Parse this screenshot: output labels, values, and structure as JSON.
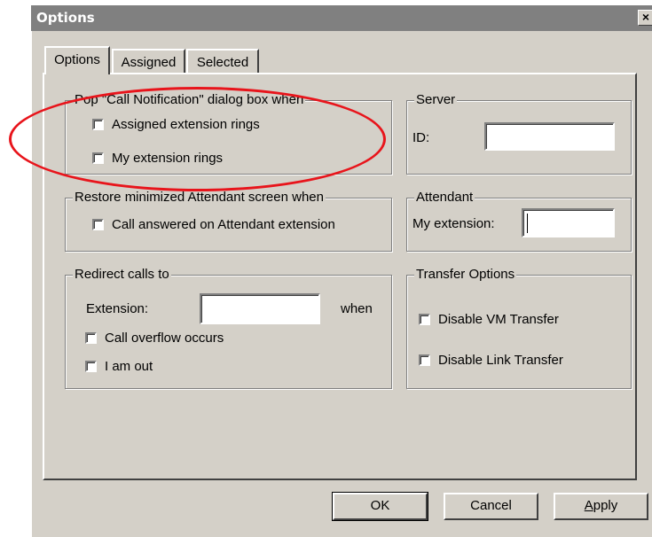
{
  "window": {
    "title": "Options",
    "close_glyph": "×"
  },
  "tabs": [
    {
      "label": "Options",
      "active": true
    },
    {
      "label": "Assigned",
      "active": false
    },
    {
      "label": "Selected",
      "active": false
    }
  ],
  "groups": {
    "popup": {
      "legend": "Pop \"Call Notification\" dialog box when",
      "options": [
        {
          "label": "Assigned extension rings",
          "checked": false
        },
        {
          "label": "My extension rings",
          "checked": false
        }
      ]
    },
    "server": {
      "legend": "Server",
      "id_label": "ID:",
      "id_value": ""
    },
    "restore": {
      "legend": "Restore minimized Attendant screen when",
      "options": [
        {
          "label": "Call answered on Attendant extension",
          "checked": false
        }
      ]
    },
    "attendant": {
      "legend": "Attendant",
      "ext_label": "My extension:",
      "ext_value": ""
    },
    "redirect": {
      "legend": "Redirect calls to",
      "ext_label": "Extension:",
      "ext_value": "",
      "when_label": "when",
      "options": [
        {
          "label": "Call overflow occurs",
          "checked": false
        },
        {
          "label": "I am out",
          "checked": false
        }
      ]
    },
    "transfer": {
      "legend": "Transfer Options",
      "options": [
        {
          "label": "Disable VM Transfer",
          "checked": false
        },
        {
          "label": "Disable Link Transfer",
          "checked": false
        }
      ]
    }
  },
  "buttons": {
    "ok": "OK",
    "cancel": "Cancel",
    "apply": "Apply"
  },
  "annotation": {
    "shape": "ellipse",
    "color": "#e8141b"
  }
}
